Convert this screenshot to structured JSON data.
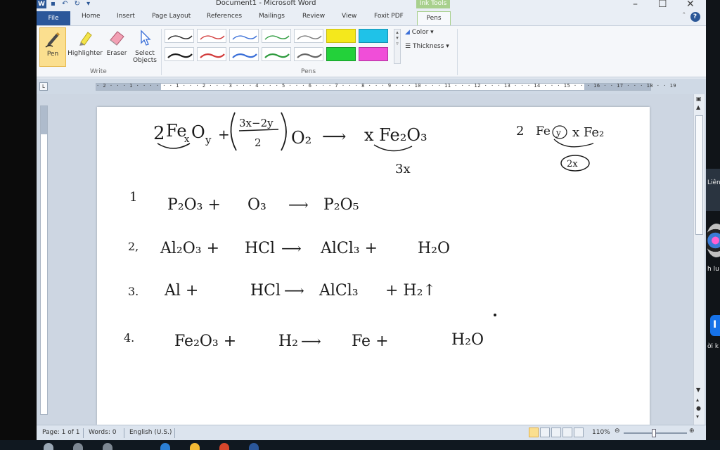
{
  "window": {
    "title": "Document1 - Microsoft Word",
    "contextual_tab_group": "Ink Tools",
    "quick_access_icon": "W"
  },
  "tabs": [
    {
      "label": "File"
    },
    {
      "label": "Home"
    },
    {
      "label": "Insert"
    },
    {
      "label": "Page Layout"
    },
    {
      "label": "References"
    },
    {
      "label": "Mailings"
    },
    {
      "label": "Review"
    },
    {
      "label": "View"
    },
    {
      "label": "Foxit PDF"
    },
    {
      "label": "Pens"
    }
  ],
  "ribbon": {
    "write_group": {
      "label": "Write",
      "pen": "Pen",
      "highlighter": "Highlighter",
      "eraser": "Eraser",
      "select_line1": "Select",
      "select_line2": "Objects"
    },
    "pens_group": {
      "label": "Pens"
    },
    "color": "Color",
    "thickness": "Thickness",
    "pen_colors": [
      "#222222",
      "#d23b3b",
      "#3a6fd8",
      "#2e9b3e",
      "#7a7a7a",
      "#f4e81c",
      "#1fc2e8",
      "#1b1b1b",
      "#d23b3b",
      "#3a6fd8",
      "#2e9b3e",
      "#666666",
      "#23d13a",
      "#f04ed8"
    ]
  },
  "ruler": {
    "numbers": "· 2 · · · 1 · · ·   · · · 1 · · · 2 · · · 3 · · · 4 · · · 5 · · · 6 · · · 7 · · · 8 · · · 9 · · · 10 · · · 11 · · · 12 · · · 13 · · · 14 · · · 15 · · · 16 ·   · 17 · · · 18 · · 19"
  },
  "ink": {
    "eq_top_left": "2 Fe₃Oᵧ + (3x−2y / 2) O₂ ⟶ x Fe₂O₃",
    "eq_top_coef": "2",
    "eq_top_fe": "Fe",
    "eq_top_x": "x",
    "eq_top_y": "y",
    "eq_top_plus": "+",
    "eq_top_num": "3x−2y",
    "eq_top_den": "2",
    "eq_top_o2": "O₂",
    "eq_top_arrow": "⟶",
    "eq_top_prod": "x Fe₂O₃",
    "eq_top_note": "3x",
    "eq_right": "2 Fe 2y  x Fe₂",
    "eq_right_coef": "2",
    "eq_right_fe": "Fe",
    "eq_right_y": "y",
    "eq_right_prod": "x Fe₂",
    "eq_right_circle": "2x",
    "rows": [
      {
        "num": "1",
        "r1": "P₂O₃ +",
        "r2": "O₃",
        "arrow": "⟶",
        "p1": "P₂O₅",
        "p2": ""
      },
      {
        "num": "2,",
        "r1": "Al₂O₃ +",
        "r2": "HCl",
        "arrow": "⟶",
        "p1": "AlCl₃ +",
        "p2": "H₂O"
      },
      {
        "num": "3.",
        "r1": "Al +",
        "r2": "HCl",
        "arrow": "⟶",
        "p1": "AlCl₃",
        "p2": "+  H₂↑"
      },
      {
        "num": "4.",
        "r1": "Fe₂O₃ +",
        "r2": "H₂",
        "arrow": "⟶",
        "p1": "Fe  +",
        "p2": "H₂O"
      }
    ]
  },
  "status": {
    "page": "Page: 1 of 1",
    "words": "Words: 0",
    "language": "English (U.S.)",
    "zoom": "110%"
  },
  "right_strip": {
    "label1": "Liên",
    "label2": "h lu",
    "label3": "ời k",
    "blue_icon": "I"
  }
}
